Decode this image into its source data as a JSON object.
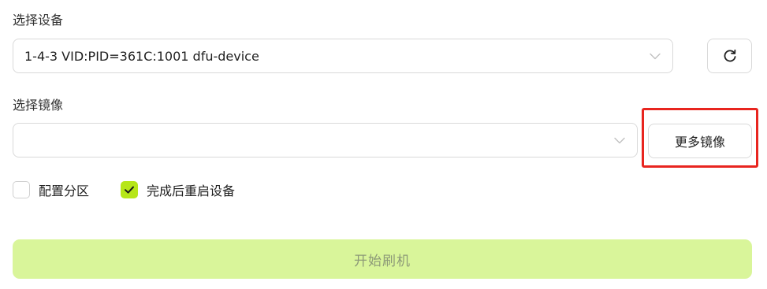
{
  "device_section": {
    "label": "选择设备",
    "selected_device": "1-4-3 VID:PID=361C:1001 dfu-device",
    "refresh_icon": "refresh-icon"
  },
  "image_section": {
    "label": "选择镜像",
    "selected_image": "",
    "more_images_label": "更多镜像"
  },
  "options": {
    "configure_partition_label": "配置分区",
    "configure_partition_checked": false,
    "reboot_after_label": "完成后重启设备",
    "reboot_after_checked": true
  },
  "actions": {
    "start_flash_label": "开始刷机",
    "start_flash_enabled": false
  },
  "colors": {
    "accent": "#b6e619",
    "disabled_button_bg": "#d9f59a",
    "highlight_box": "#e8251f"
  }
}
